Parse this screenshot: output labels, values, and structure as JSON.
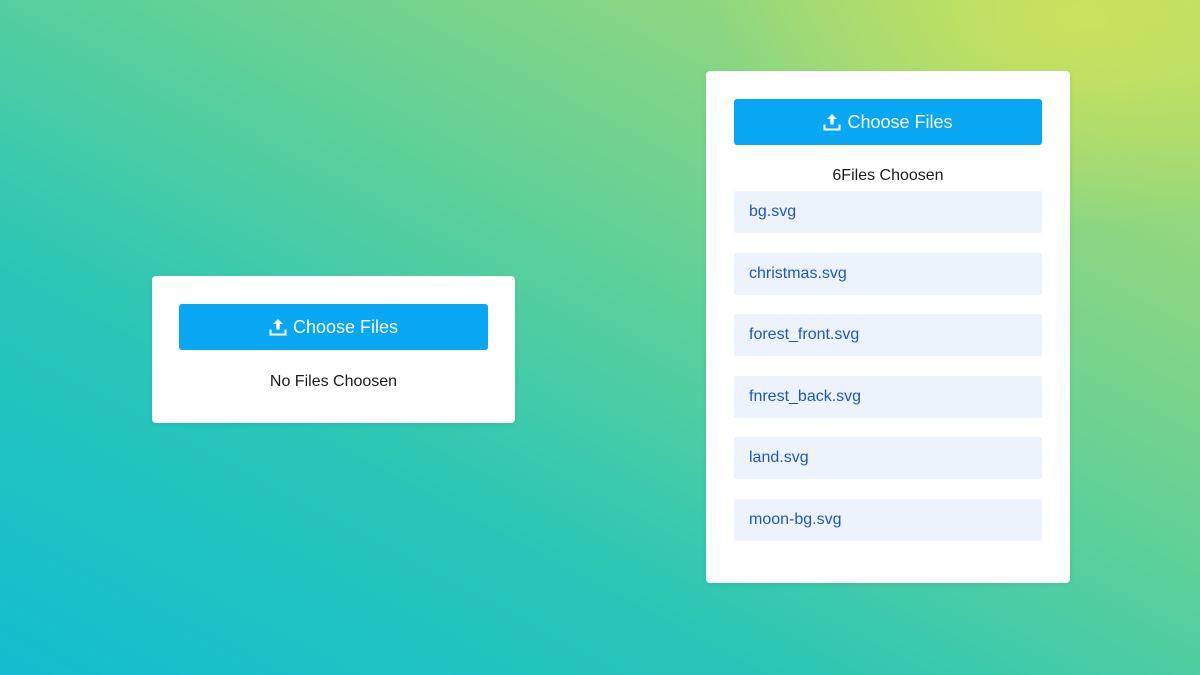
{
  "left_card": {
    "button_label": "Choose Files",
    "status": "No Files Choosen"
  },
  "right_card": {
    "button_label": "Choose Files",
    "status": "6Files Choosen",
    "files": [
      "bg.svg",
      "christmas.svg",
      "forest_front.svg",
      "fnrest_back.svg",
      "land.svg",
      "moon-bg.svg"
    ]
  },
  "icons": {
    "upload": "upload-icon"
  },
  "colors": {
    "button": "#08a7f4",
    "file_item_bg": "#edf3fd",
    "file_item_text": "#1e56c2",
    "card_bg": "#ffffff"
  }
}
